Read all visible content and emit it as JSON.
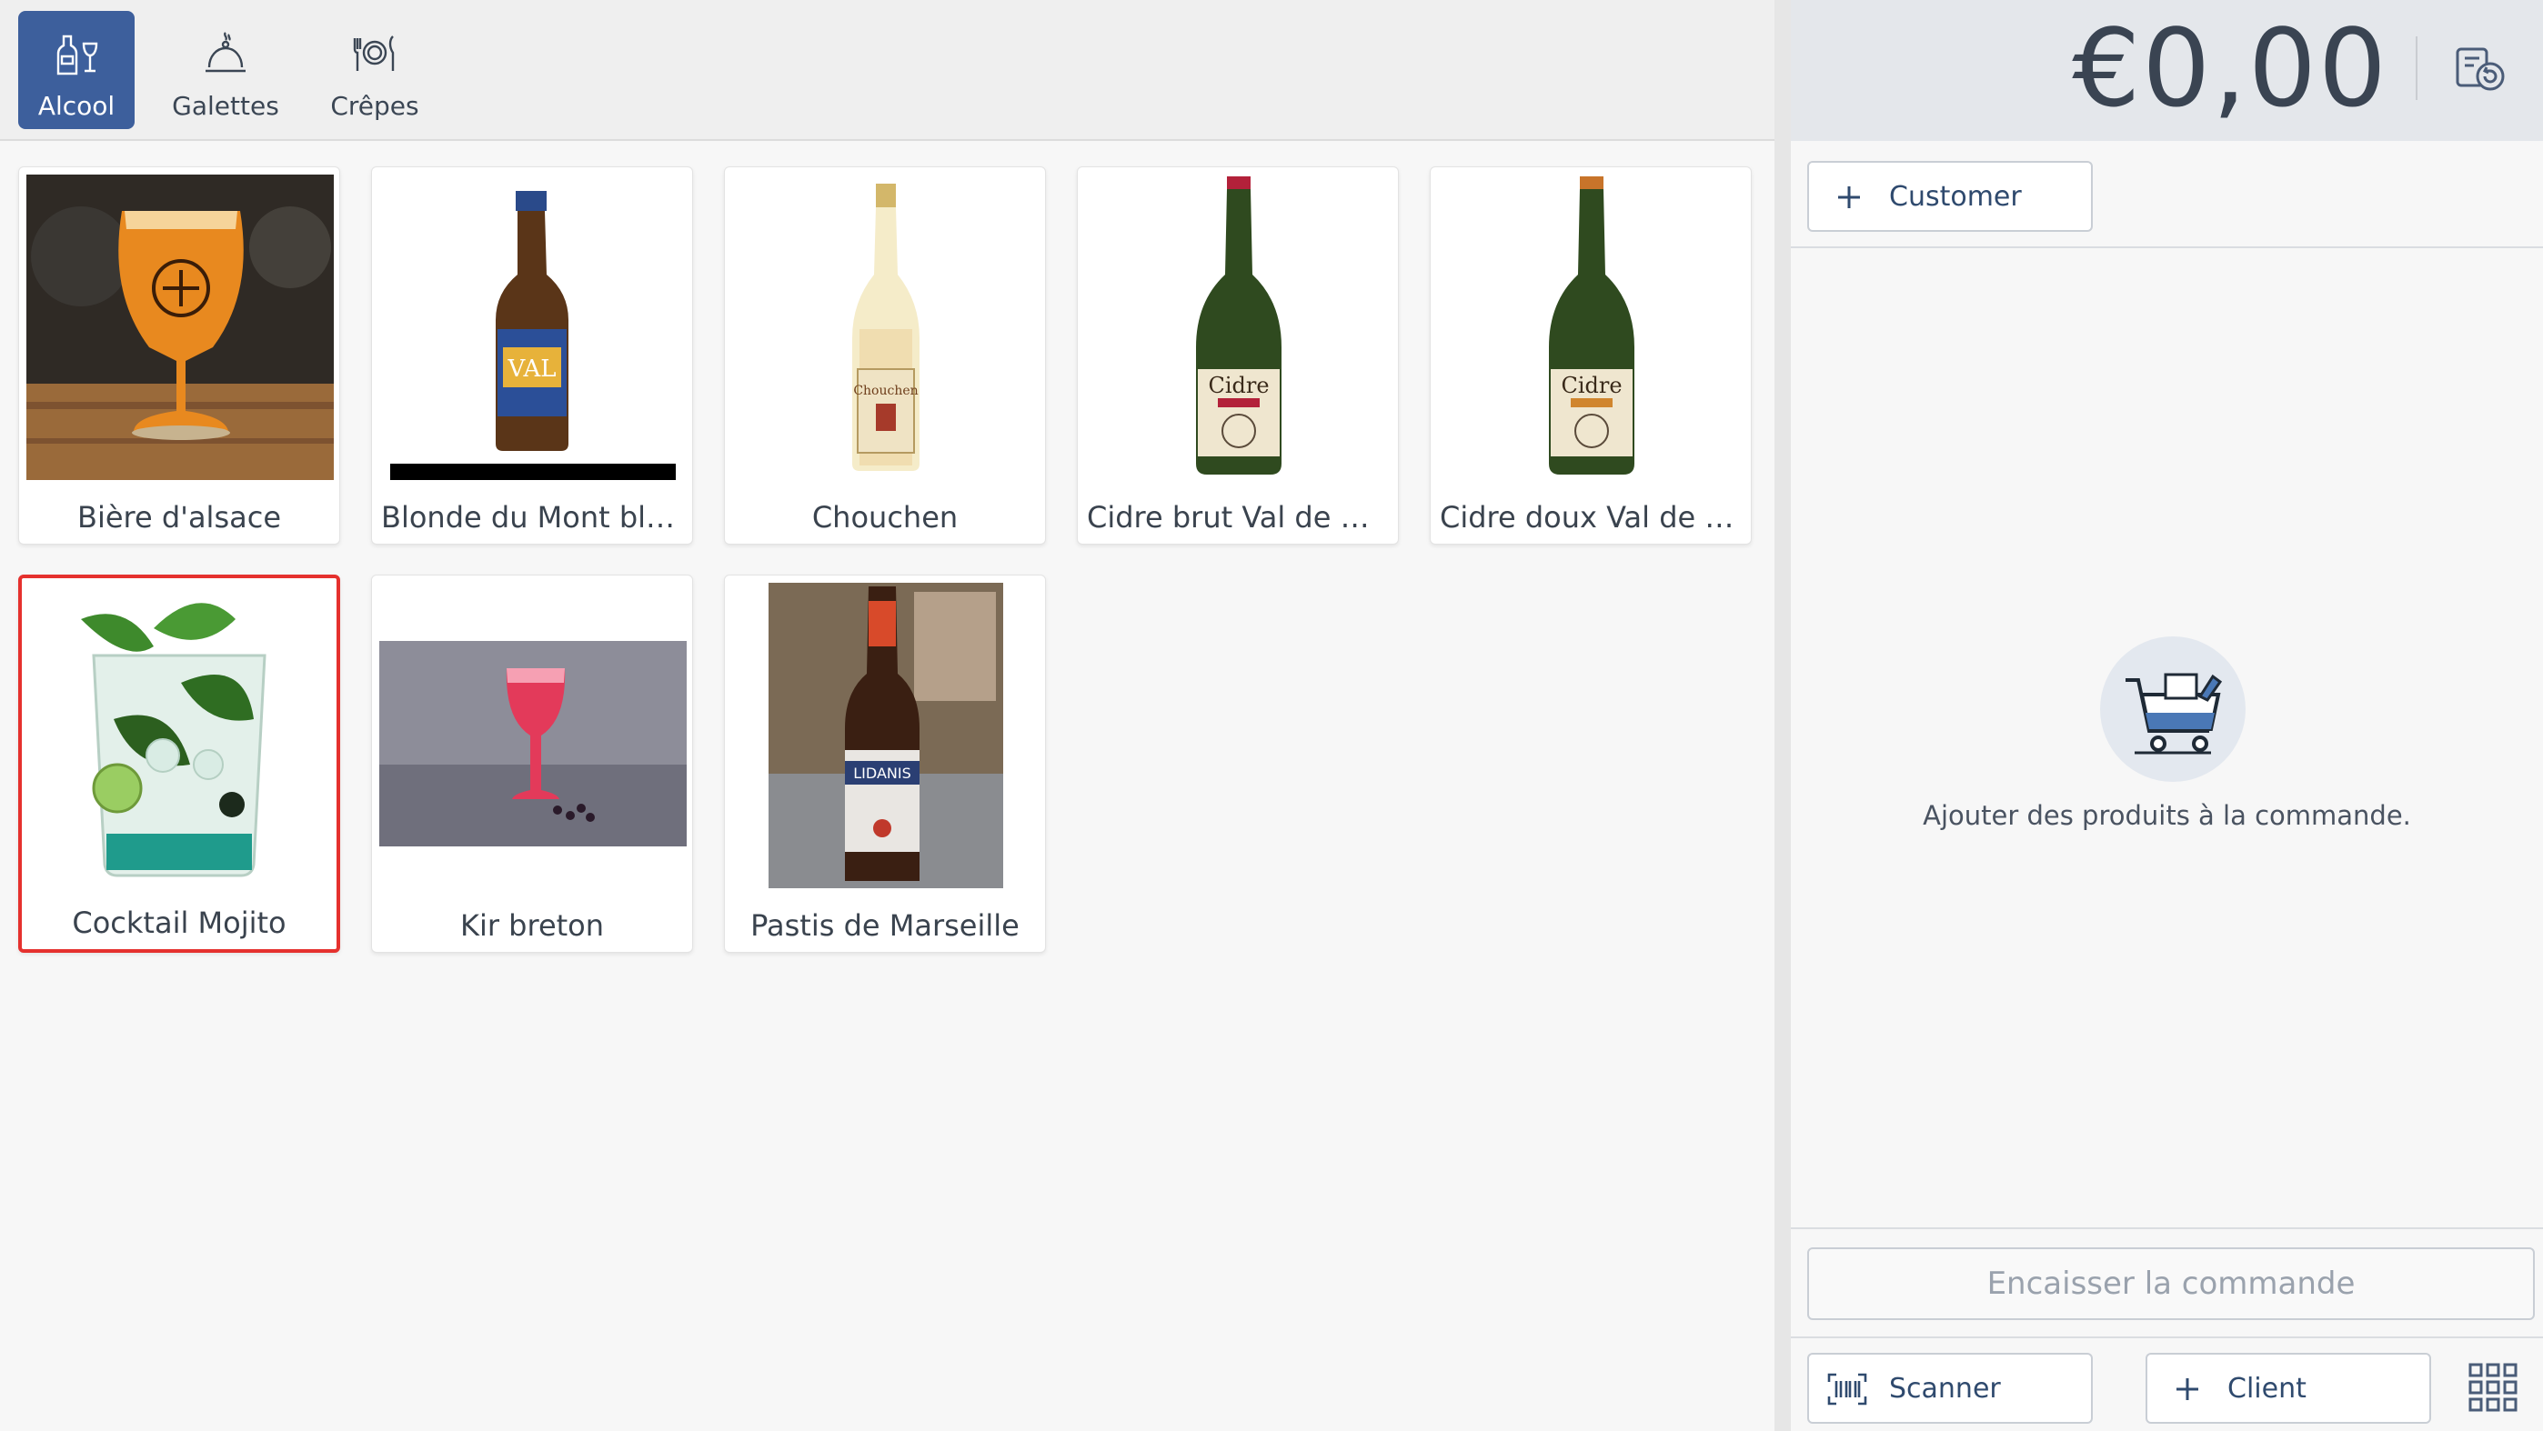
{
  "categories": [
    {
      "label": "Alcool",
      "icon": "wine-bottle-glass-icon",
      "active": true
    },
    {
      "label": "Galettes",
      "icon": "cloche-icon",
      "active": false
    },
    {
      "label": "Crêpes",
      "icon": "plate-cutlery-icon",
      "active": false
    }
  ],
  "products": [
    {
      "name": "Bière d'alsace",
      "image": "beer-glass-image"
    },
    {
      "name": "Blonde du Mont blanc",
      "image": "beer-bottle-image"
    },
    {
      "name": "Chouchen",
      "image": "chouchen-bottle-image"
    },
    {
      "name": "Cidre brut Val de Ranc...",
      "image": "cider-brut-bottle-image"
    },
    {
      "name": "Cidre doux Val de Ran...",
      "image": "cider-doux-bottle-image"
    },
    {
      "name": "Cocktail Mojito",
      "image": "mojito-glass-image",
      "selected": true
    },
    {
      "name": "Kir breton",
      "image": "kir-glass-image"
    },
    {
      "name": "Pastis de Marseille",
      "image": "pastis-bottle-image"
    }
  ],
  "order": {
    "total": "€0,00",
    "customer_button": "Customer",
    "empty_message": "Ajouter des produits à la commande.",
    "checkout_button": "Encaisser la commande"
  },
  "bottom": {
    "scanner_button": "Scanner",
    "client_button": "Client"
  },
  "colors": {
    "accent": "#3d5f9c",
    "selection": "#e5312e"
  }
}
